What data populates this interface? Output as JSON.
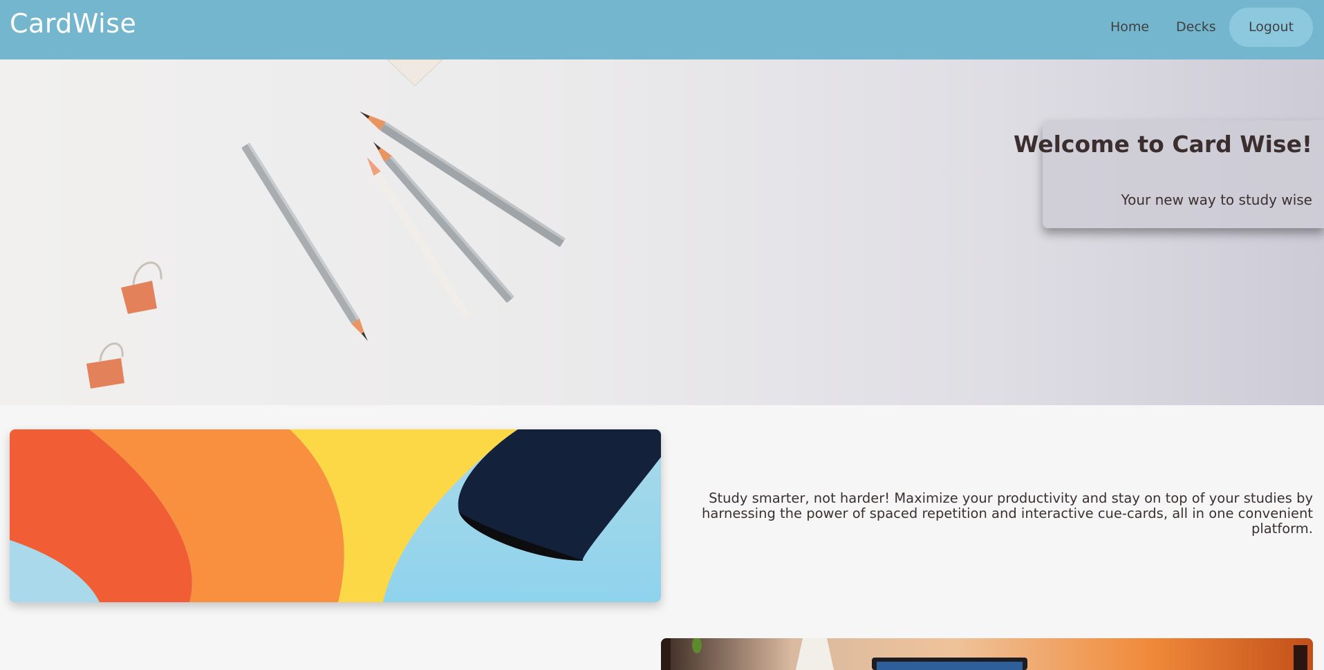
{
  "navbar": {
    "brand": "CardWise",
    "links": [
      {
        "label": "Home"
      },
      {
        "label": "Decks"
      }
    ],
    "logout_label": "Logout",
    "background_color": "#75b6cf"
  },
  "hero": {
    "title": "Welcome to Card Wise!",
    "subtitle": "Your new way to study wise"
  },
  "features": {
    "description": "Study smarter, not harder! Maximize your productivity and stay on top of your studies by harnessing the power of spaced repetition and interactive cue-cards, all in one convenient platform."
  }
}
